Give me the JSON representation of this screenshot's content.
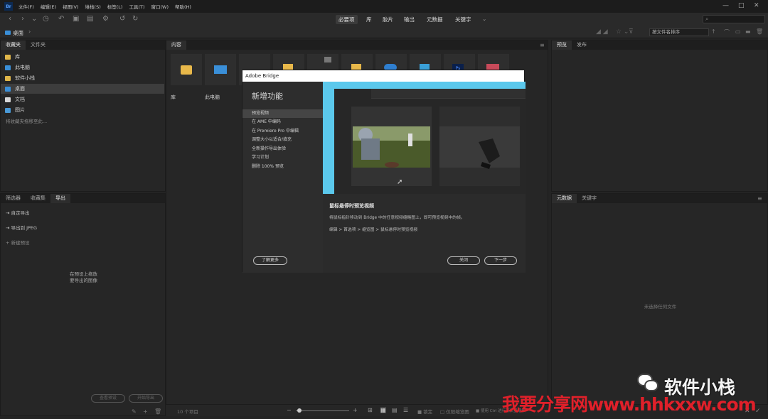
{
  "app": {
    "logo": "Br"
  },
  "menu": [
    "文件(F)",
    "编辑(E)",
    "视图(V)",
    "堆栈(S)",
    "标签(L)",
    "工具(T)",
    "窗口(W)",
    "帮助(H)"
  ],
  "window_controls": {
    "minimize": "—",
    "maximize": "□",
    "close": "✕"
  },
  "workspaces": [
    "必要项",
    "库",
    "胶片",
    "输出",
    "元数据",
    "关键字"
  ],
  "workspace_active": "必要项",
  "search": {
    "placeholder": "⌕"
  },
  "path": {
    "current": "桌面"
  },
  "sort": {
    "label": "按文件名排序"
  },
  "favorites_panel": {
    "tabs": [
      "收藏夹",
      "文件夹"
    ],
    "items": [
      "库",
      "此电脑",
      "软件小栈",
      "桌面",
      "文档",
      "图片"
    ],
    "selected": "桌面",
    "hint": "将收藏夹拖移至此..."
  },
  "export_panel": {
    "tabs": [
      "筛选器",
      "收藏集",
      "导出"
    ],
    "items": [
      "自定导出",
      "导出到 JPEG",
      "新建预设"
    ],
    "empty_hint_line1": "在预设上拖放",
    "empty_hint_line2": "要导出的图像",
    "buttons": [
      "查看预设",
      "开始导出"
    ]
  },
  "content_panel": {
    "tab": "内容",
    "items": [
      "库",
      "此电脑"
    ]
  },
  "preview_panel": {
    "tabs": [
      "预览",
      "发布"
    ]
  },
  "metadata_panel": {
    "tabs": [
      "元数据",
      "关键字"
    ],
    "empty": "未选择任何文件"
  },
  "dialog": {
    "title": "Adobe Bridge",
    "heading": "新增功能",
    "features": [
      "预览视频",
      "在 AME 中编码",
      "在 Premiere Pro 中编辑",
      "调整大小以适合/填充",
      "全新操作导出体验",
      "学习计划",
      "删除 100% 预览"
    ],
    "selected_feature": "预览视频",
    "learn_more": "了解更多",
    "desc_title": "鼠标悬停时预览视频",
    "desc_body": "将鼠标指针移动到 Bridge 中的任意视频缩略图上，即可预览视频中的帧。",
    "desc_path": "编辑 > 首选项 > 缩览图 > 鼠标悬停时预览视频",
    "close": "关闭",
    "next": "下一步"
  },
  "statusbar": {
    "items_count": "10 个项目",
    "lock": "锁定",
    "recent": "仅限缩览图",
    "hint": "使用 Ctrl 进行高质量缩放"
  },
  "watermark": {
    "wechat": "软件小栈",
    "site": "我要分享网www.hhkxxw.com"
  },
  "colors": {
    "accent": "#5bc8ec",
    "selection": "#3d3d3d",
    "watermark_red": "#e0202a"
  }
}
